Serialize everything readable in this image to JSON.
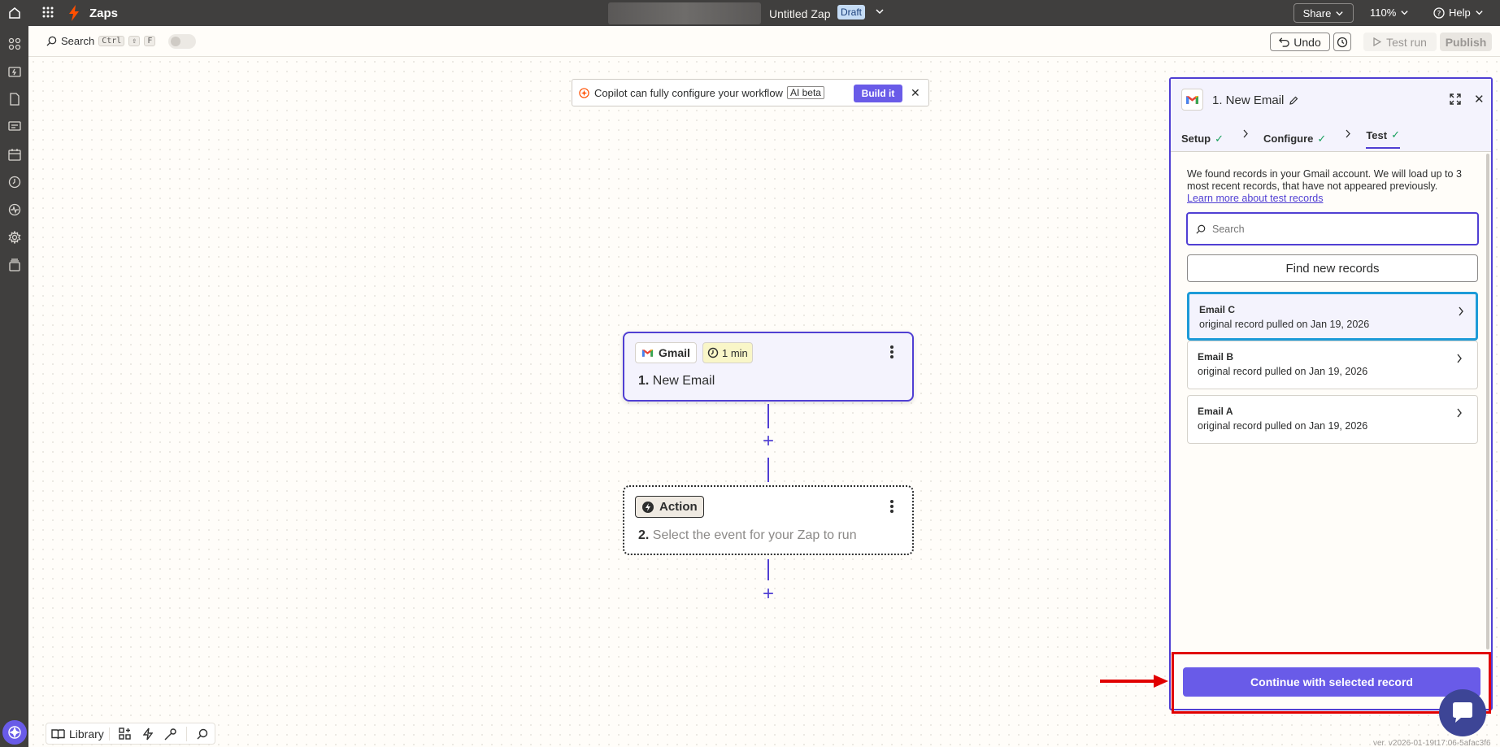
{
  "topbar": {
    "app_title": "Zaps",
    "zap_name": "Untitled Zap",
    "status_badge": "Draft",
    "share_label": "Share",
    "zoom_level": "110%",
    "help_label": "Help"
  },
  "toolbar": {
    "search_label": "Search",
    "shortcut_keys": [
      "Ctrl",
      "⇧",
      "F"
    ],
    "undo_label": "Undo",
    "test_run_label": "Test run",
    "publish_label": "Publish"
  },
  "copilot": {
    "text": "Copilot can fully configure your workflow",
    "beta_label": "AI beta",
    "build_label": "Build it",
    "close_glyph": "✕"
  },
  "nodes": [
    {
      "app_label": "Gmail",
      "time_label": "1 min",
      "number": "1.",
      "title": "New Email"
    },
    {
      "app_label": "Action",
      "number": "2.",
      "title": "Select the event for your Zap to run"
    }
  ],
  "panel": {
    "title": "1. New Email",
    "steps": [
      {
        "label": "Setup",
        "check": "✓"
      },
      {
        "label": "Configure",
        "check": "✓"
      },
      {
        "label": "Test",
        "check": "✓"
      }
    ],
    "description": "We found records in your Gmail account. We will load up to 3 most recent records, that have not appeared previously.",
    "learn_more_link": "Learn more about test records",
    "search_placeholder": "Search",
    "find_button": "Find new records",
    "records": [
      {
        "name": "Email C",
        "subtitle": "original record pulled on Jan 19, 2026",
        "selected": true
      },
      {
        "name": "Email B",
        "subtitle": "original record pulled on Jan 19, 2026",
        "selected": false
      },
      {
        "name": "Email A",
        "subtitle": "original record pulled on Jan 19, 2026",
        "selected": false
      }
    ],
    "continue_button": "Continue with selected record"
  },
  "bottombar": {
    "library_label": "Library"
  },
  "version_text": "ver. v2026-01-19t17:06-5afac3f6",
  "colors": {
    "accent": "#695be8",
    "node_border": "#503fd3",
    "selected_record_border": "#1d9bd8",
    "annotation_red": "#e10000",
    "topbar_bg": "#403f3e"
  }
}
